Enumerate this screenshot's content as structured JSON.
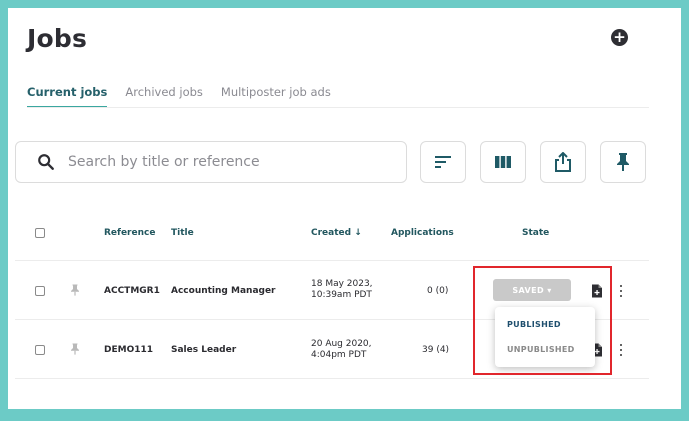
{
  "page": {
    "title": "Jobs"
  },
  "header": {
    "add_icon": "plus-circle-icon"
  },
  "tabs": [
    {
      "label": "Current jobs",
      "active": true
    },
    {
      "label": "Archived jobs",
      "active": false
    },
    {
      "label": "Multiposter job ads",
      "active": false
    }
  ],
  "search": {
    "placeholder": "Search by title or reference",
    "icon": "search-icon"
  },
  "toolbar": {
    "buttons": [
      "sort-icon",
      "columns-icon",
      "export-icon",
      "pin-icon"
    ]
  },
  "table": {
    "headers": {
      "reference": "Reference",
      "title": "Title",
      "created": "Created ↓",
      "applications": "Applications",
      "state": "State"
    },
    "rows": [
      {
        "reference": "ACCTMGR1",
        "title": "Accounting Manager",
        "created_date": "18 May 2023,",
        "created_time": "10:39am PDT",
        "applications": "0 (0)",
        "state": "SAVED ▾"
      },
      {
        "reference": "DEMO111",
        "title": "Sales Leader",
        "created_date": "20 Aug 2020,",
        "created_time": "4:04pm PDT",
        "applications": "39 (4)"
      }
    ]
  },
  "state_menu": {
    "items": [
      {
        "label": "PUBLISHED",
        "color": "#1f4f6e"
      },
      {
        "label": "UNPUBLISHED",
        "color": "#8a8a8a"
      }
    ]
  },
  "colors": {
    "accent": "#3aa7a0",
    "header_text": "#22575f",
    "frame": "#6ccbc6",
    "highlight": "#e1262c"
  }
}
